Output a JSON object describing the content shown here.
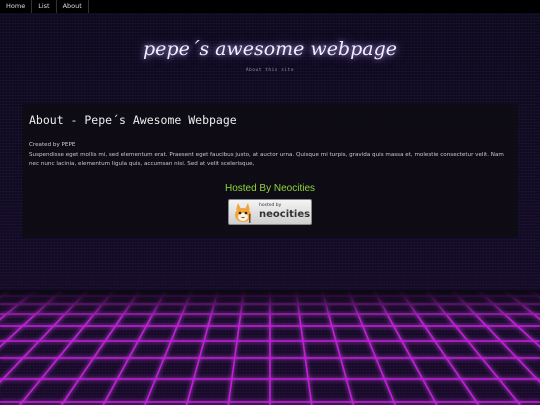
{
  "nav": {
    "items": [
      {
        "label": "Home"
      },
      {
        "label": "List"
      },
      {
        "label": "About"
      }
    ]
  },
  "header": {
    "title": "pepe´s awesome webpage",
    "subtitle": "About this site"
  },
  "content": {
    "heading": "About - Pepe´s Awesome Webpage",
    "created_by": "Created by PEPE",
    "paragraph": "Suspendisse eget mollis mi, sed elementum erat. Praesent eget faucibus justo, at auctor urna. Quisque mi turpis, gravida quis massa et, molestie consectetur velit. Nam nec nunc lacinia, elementum ligula quis, accumsan nisi. Sed at velit scelerisque,",
    "hosted_by": "Hosted By Neocities",
    "badge": {
      "small_text": "hosted by",
      "big_text": "neocities"
    }
  },
  "colors": {
    "grid_line": "#c21fd6",
    "hosted_text": "#8fd63a",
    "background": "#0b0714"
  }
}
